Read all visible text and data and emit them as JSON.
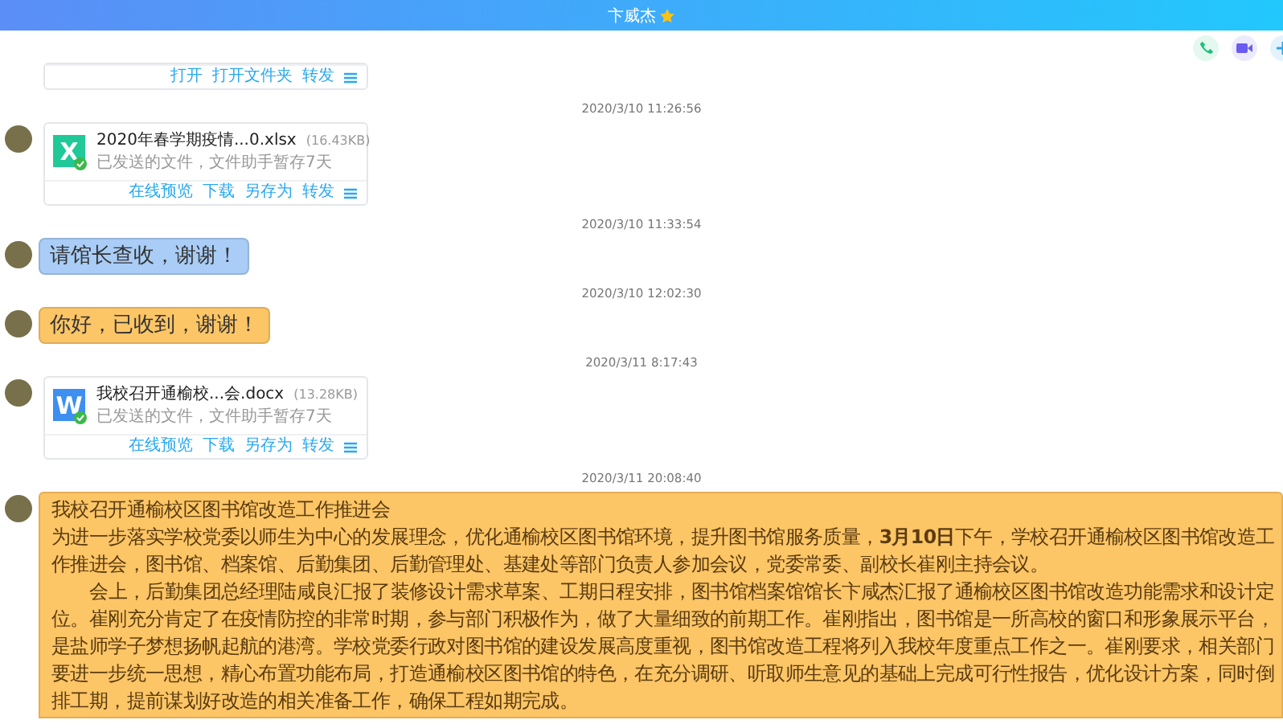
{
  "header": {
    "title": "卞威杰",
    "starred": true
  },
  "messages": [
    {
      "kind": "file_actions",
      "actions": [
        "打开",
        "打开文件夹",
        "转发"
      ]
    },
    {
      "kind": "time",
      "text": "2020/3/10 11:26:56"
    },
    {
      "kind": "file",
      "color": "#20c997",
      "icon_letter": "X",
      "name": "2020年春学期疫情...0.xlsx",
      "size": "(16.43KB)",
      "status": "已发送的文件，文件助手暂存7天",
      "actions": [
        "在线预览",
        "下载",
        "另存为",
        "转发"
      ]
    },
    {
      "kind": "time",
      "text": "2020/3/10 11:33:54"
    },
    {
      "kind": "text",
      "color": "#a9cdf6",
      "text": "请馆长查收，谢谢！"
    },
    {
      "kind": "time",
      "text": "2020/3/10 12:02:30"
    },
    {
      "kind": "text",
      "color": "#fcc566",
      "text": "你好，已收到，谢谢！"
    },
    {
      "kind": "time",
      "text": "2020/3/11 8:17:43"
    },
    {
      "kind": "file",
      "color": "#3d8ff0",
      "icon_letter": "W",
      "name": "我校召开通榆校...会.docx",
      "size": "(13.28KB)",
      "status": "已发送的文件，文件助手暂存7天",
      "actions": [
        "在线预览",
        "下载",
        "另存为",
        "转发"
      ]
    },
    {
      "kind": "time",
      "text": "2020/3/11 20:08:40"
    },
    {
      "kind": "article",
      "color": "#fcc566",
      "title": "我校召开通榆校区图书馆改造工作推进会",
      "paragraphs": [
        {
          "indent": false,
          "text": "为进一步落实学校党委以师生为中心的发展理念，优化通榆校区图书馆环境，提升图书馆服务质量，**3月10日**下午，学校召开通榆校区图书馆改造工作推进会，图书馆、档案馆、后勤集团、后勤管理处、基建处等部门负责人参加会议，党委常委、副校长崔刚主持会议。"
        },
        {
          "indent": true,
          "text": "会上，后勤集团总经理陆咸良汇报了装修设计需求草案、工期日程安排，图书馆档案馆馆长卞咸杰汇报了通榆校区图书馆改造功能需求和设计定位。崔刚充分肯定了在疫情防控的非常时期，参与部门积极作为，做了大量细致的前期工作。崔刚指出，图书馆是一所高校的窗口和形象展示平台，是盐师学子梦想扬帆起航的港湾。学校党委行政对图书馆的建设发展高度重视，图书馆改造工程将列入我校年度重点工作之一。崔刚要求，相关部门要进一步统一思想，精心布置功能布局，打造通榆校区图书馆的特色，在充分调研、听取师生意见的基础上完成可行性报告，优化设计方案，同时倒排工期，提前谋划好改造的相关准备工作，确保工程如期完成。"
        }
      ]
    }
  ]
}
